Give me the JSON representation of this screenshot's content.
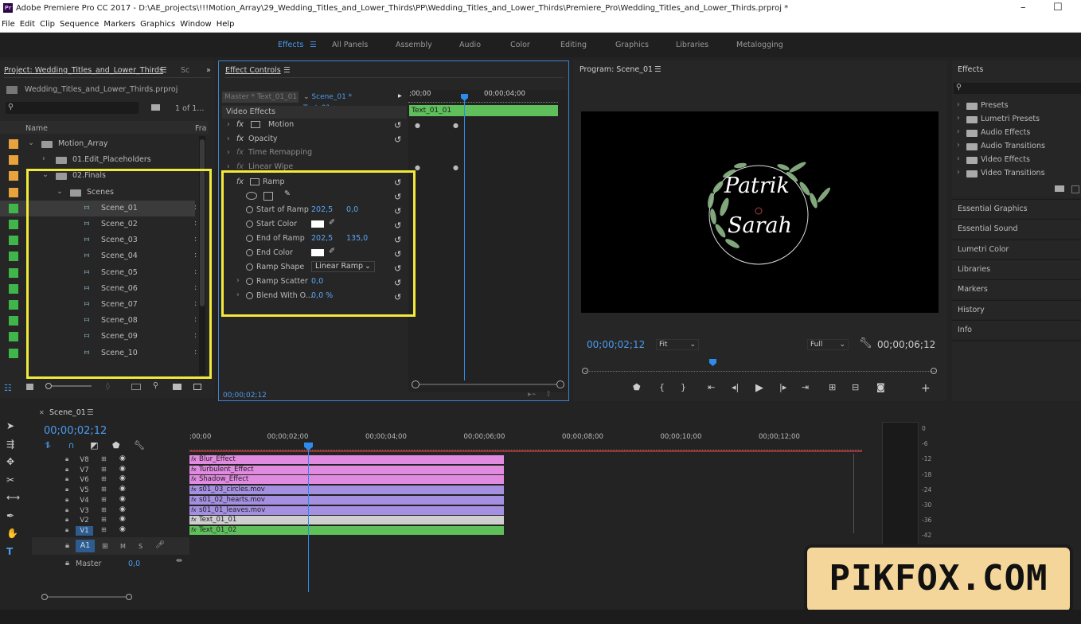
{
  "window": {
    "title": "Adobe Premiere Pro CC 2017 - D:\\AE_projects\\!!!Motion_Array\\29_Wedding_Titles_and_Lower_Thirds\\PP\\Wedding_Titles_and_Lower_Thirds\\Premiere_Pro\\Wedding_Titles_and_Lower_Thirds.prproj *",
    "logo": "Pr"
  },
  "menu": [
    "File",
    "Edit",
    "Clip",
    "Sequence",
    "Markers",
    "Graphics",
    "Window",
    "Help"
  ],
  "workspaces": [
    "Effects",
    "All Panels",
    "Assembly",
    "Audio",
    "Color",
    "Editing",
    "Graphics",
    "Libraries",
    "Metalogging"
  ],
  "project": {
    "tab": "Project: Wedding_Titles_and_Lower_Thirds",
    "tab2": "Sc",
    "file": "Wedding_Titles_and_Lower_Thirds.prproj",
    "count": "1 of 1...",
    "col_name": "Name",
    "col_fr": "Fra",
    "items": [
      {
        "label": "Motion_Array",
        "kind": "folder",
        "indent": 0,
        "color": "#e8a33d"
      },
      {
        "label": "01.Edit_Placeholders",
        "kind": "folder",
        "indent": 1,
        "color": "#e8a33d"
      },
      {
        "label": "02.Finals",
        "kind": "folder",
        "indent": 1,
        "color": "#e8a33d"
      },
      {
        "label": "Scenes",
        "kind": "folder",
        "indent": 2,
        "color": "#e8a33d"
      },
      {
        "label": "Scene_01",
        "kind": "seq",
        "indent": 3,
        "color": "#3fb54a"
      },
      {
        "label": "Scene_02",
        "kind": "seq",
        "indent": 3,
        "color": "#3fb54a"
      },
      {
        "label": "Scene_03",
        "kind": "seq",
        "indent": 3,
        "color": "#3fb54a"
      },
      {
        "label": "Scene_04",
        "kind": "seq",
        "indent": 3,
        "color": "#3fb54a"
      },
      {
        "label": "Scene_05",
        "kind": "seq",
        "indent": 3,
        "color": "#3fb54a"
      },
      {
        "label": "Scene_06",
        "kind": "seq",
        "indent": 3,
        "color": "#3fb54a"
      },
      {
        "label": "Scene_07",
        "kind": "seq",
        "indent": 3,
        "color": "#3fb54a"
      },
      {
        "label": "Scene_08",
        "kind": "seq",
        "indent": 3,
        "color": "#3fb54a"
      },
      {
        "label": "Scene_09",
        "kind": "seq",
        "indent": 3,
        "color": "#3fb54a"
      },
      {
        "label": "Scene_10",
        "kind": "seq",
        "indent": 3,
        "color": "#3fb54a"
      }
    ]
  },
  "effect_controls": {
    "tab": "Effect Controls",
    "master": "Master * Text_01_01",
    "seq": "Scene_01 * Text_01...",
    "section": "Video Effects",
    "ruler_start": ";00;00",
    "ruler_mid": "00;00;04;00",
    "clip_label": "Text_01_01",
    "effects": [
      "Motion",
      "Opacity",
      "Time Remapping",
      "Linear Wipe",
      "Ramp"
    ],
    "ramp": {
      "start_label": "Start of Ramp",
      "start_x": "202,5",
      "start_y": "0,0",
      "start_color_label": "Start Color",
      "end_label": "End of Ramp",
      "end_x": "202,5",
      "end_y": "135,0",
      "end_color_label": "End Color",
      "shape_label": "Ramp Shape",
      "shape_value": "Linear Ramp",
      "scatter_label": "Ramp Scatter",
      "scatter_value": "0,0",
      "blend_label": "Blend With O...",
      "blend_value": "0,0 %"
    },
    "timecode": "00;00;02;12"
  },
  "program": {
    "tab": "Program: Scene_01",
    "name1": "Patrik",
    "name2": "Sarah",
    "timecode": "00;00;02;12",
    "fit": "Fit",
    "quality": "Full",
    "duration": "00;00;06;12"
  },
  "effects_panel": {
    "tab": "Effects",
    "tree": [
      "Presets",
      "Lumetri Presets",
      "Audio Effects",
      "Audio Transitions",
      "Video Effects",
      "Video Transitions"
    ],
    "panels": [
      "Essential Graphics",
      "Essential Sound",
      "Lumetri Color",
      "Libraries",
      "Markers",
      "History",
      "Info"
    ]
  },
  "timeline": {
    "tab": "Scene_01",
    "timecode": "00;00;02;12",
    "ruler": [
      ";00;00",
      "00;00;02;00",
      "00;00;04;00",
      "00;00;06;00",
      "00;00;08;00",
      "00;00;10;00",
      "00;00;12;00"
    ],
    "tracks": [
      "V8",
      "V7",
      "V6",
      "V5",
      "V4",
      "V3",
      "V2",
      "V1"
    ],
    "audio": "A1",
    "master": "Master",
    "master_val": "0,0",
    "clips": [
      {
        "name": "Blur_Effect",
        "color": "#e08ae0"
      },
      {
        "name": "Turbulent_Effect",
        "color": "#e08ae0"
      },
      {
        "name": "Shadow_Effect",
        "color": "#e08ae0"
      },
      {
        "name": "s01_03_circles.mov",
        "color": "#a58fe0"
      },
      {
        "name": "s01_02_hearts.mov",
        "color": "#a58fe0"
      },
      {
        "name": "s01_01_leaves.mov",
        "color": "#a58fe0"
      },
      {
        "name": "Text_01_01",
        "color": "#cfcfcf"
      },
      {
        "name": "Text_01_02",
        "color": "#5fbf5a"
      }
    ],
    "meter": [
      "0",
      "-6",
      "-12",
      "-18",
      "-24",
      "-30",
      "-36",
      "-42"
    ]
  },
  "watermark": "PIKFOX.COM",
  "colors": {
    "accent": "#2d8ceb",
    "highlight": "#f2ea3a",
    "green_clip": "#5fbf5a",
    "pink_clip": "#e08ae0",
    "purple_clip": "#a58fe0"
  }
}
